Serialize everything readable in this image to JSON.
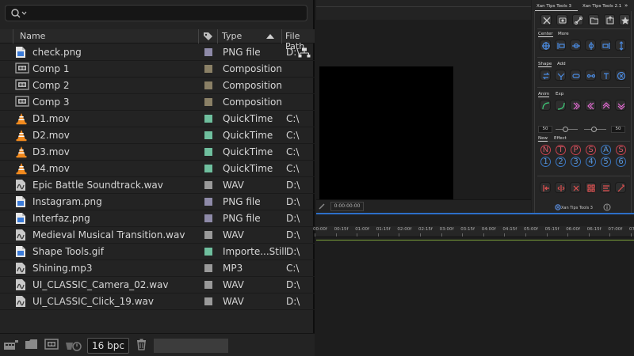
{
  "project": {
    "search": {
      "value": "",
      "placeholder": ""
    },
    "columns": {
      "name": "Name",
      "type": "Type",
      "file_path": "File Path"
    },
    "items": [
      {
        "name": "check.png",
        "type": "PNG file",
        "path": "D:\\",
        "icon": "png-file-icon",
        "label_color": "#8e8aa8",
        "extra_icon": "network-icon"
      },
      {
        "name": "Comp 1",
        "type": "Composition",
        "path": "",
        "icon": "composition-icon",
        "label_color": "#8a8066"
      },
      {
        "name": "Comp 2",
        "type": "Composition",
        "path": "",
        "icon": "composition-icon",
        "label_color": "#8a8066"
      },
      {
        "name": "Comp 3",
        "type": "Composition",
        "path": "",
        "icon": "composition-icon",
        "label_color": "#8a8066"
      },
      {
        "name": "D1.mov",
        "type": "QuickTime",
        "path": "C:\\",
        "icon": "vlc-cone-icon",
        "label_color": "#6fbf9e"
      },
      {
        "name": "D2.mov",
        "type": "QuickTime",
        "path": "C:\\",
        "icon": "vlc-cone-icon",
        "label_color": "#6fbf9e"
      },
      {
        "name": "D3.mov",
        "type": "QuickTime",
        "path": "C:\\",
        "icon": "vlc-cone-icon",
        "label_color": "#6fbf9e"
      },
      {
        "name": "D4.mov",
        "type": "QuickTime",
        "path": "C:\\",
        "icon": "vlc-cone-icon",
        "label_color": "#6fbf9e"
      },
      {
        "name": "Epic Battle Soundtrack.wav",
        "type": "WAV",
        "path": "D:\\",
        "icon": "audio-file-icon",
        "label_color": "#9a9a9a"
      },
      {
        "name": "Instagram.png",
        "type": "PNG file",
        "path": "D:\\",
        "icon": "png-file-icon",
        "label_color": "#8e8aa8"
      },
      {
        "name": "Interfaz.png",
        "type": "PNG file",
        "path": "D:\\",
        "icon": "png-file-icon",
        "label_color": "#8e8aa8"
      },
      {
        "name": "Medieval Musical Transition.wav",
        "type": "WAV",
        "path": "D:\\",
        "icon": "audio-file-icon",
        "label_color": "#9a9a9a"
      },
      {
        "name": "Shape Tools.gif",
        "type": "Importe...Still",
        "path": "D:\\",
        "icon": "png-file-icon",
        "label_color": "#6fbf9e"
      },
      {
        "name": "Shining.mp3",
        "type": "MP3",
        "path": "C:\\",
        "icon": "audio-file-icon",
        "label_color": "#9a9a9a"
      },
      {
        "name": "UI_CLASSIC_Camera_02.wav",
        "type": "WAV",
        "path": "D:\\",
        "icon": "audio-file-icon",
        "label_color": "#9a9a9a"
      },
      {
        "name": "UI_CLASSIC_Click_19.wav",
        "type": "WAV",
        "path": "D:\\",
        "icon": "audio-file-icon",
        "label_color": "#9a9a9a"
      }
    ],
    "bottom": {
      "bpc": "16 bpc"
    }
  },
  "viewer": {
    "timecode": "0:00:00:00"
  },
  "xan": {
    "tabs": [
      "Xan Tips Tools 3",
      "Xan Tips Tools 2.1"
    ],
    "sections": {
      "center": "Center",
      "more": "More",
      "shape": "Shape",
      "add": "Add",
      "anim": "Anim",
      "exp": "Exp",
      "new": "New",
      "effect": "Effect"
    },
    "anim_values": [
      "50",
      "50"
    ],
    "letters": [
      "N",
      "T",
      "P",
      "S",
      "A",
      "S"
    ],
    "letter_colors": [
      "red",
      "red",
      "red",
      "red",
      "blue",
      "red"
    ],
    "numbers": [
      "1",
      "2",
      "3",
      "4",
      "5",
      "6"
    ],
    "footer": "Xan Tips Tools 3"
  },
  "timeline": {
    "ticks": [
      "00:00f",
      "00:15f",
      "01:00f",
      "01:15f",
      "02:00f",
      "02:15f",
      "03:00f",
      "03:15f",
      "04:00f",
      "04:15f",
      "05:00f",
      "05:15f",
      "06:00f",
      "06:15f",
      "07:00f",
      "07:15f"
    ]
  },
  "colors": {
    "accent_blue": "#2d6fc8",
    "timeline_green": "#7ba23a"
  }
}
